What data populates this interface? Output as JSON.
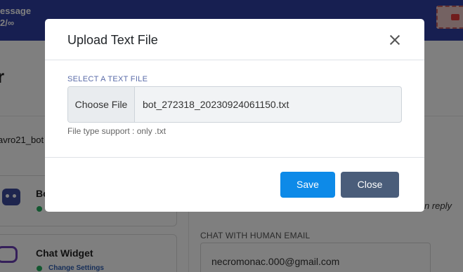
{
  "background": {
    "topbar": {
      "message_line1": "essage",
      "message_line2": "2/∞"
    },
    "heading": "r",
    "bot_name": "avro21_bot",
    "cards": [
      {
        "title": "Bo",
        "link": ""
      },
      {
        "title": "Chat Widget",
        "link": "Change Settings"
      }
    ],
    "reply_fragment": "n reply",
    "email_label": "CHAT WITH HUMAN EMAIL",
    "email_value": "necromonac.000@gmail.com"
  },
  "modal": {
    "title": "Upload Text File",
    "field_label": "SELECT A TEXT FILE",
    "choose_button": "Choose File",
    "file_name": "bot_272318_20230924061150.txt",
    "help_text": "File type support : only .txt",
    "save_button": "Save",
    "close_button": "Close"
  }
}
